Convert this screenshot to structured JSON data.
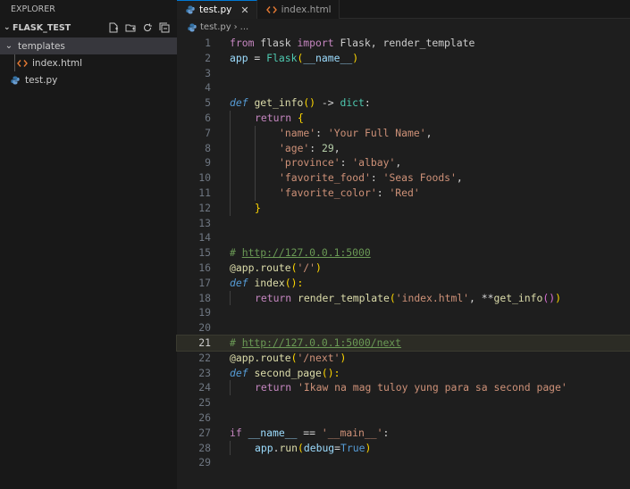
{
  "explorer": {
    "header": "EXPLORER",
    "project": "FLASK_TEST",
    "tree": [
      {
        "label": "templates",
        "type": "folder"
      },
      {
        "label": "index.html",
        "type": "html"
      },
      {
        "label": "test.py",
        "type": "python"
      }
    ]
  },
  "tabs": [
    {
      "label": "test.py",
      "active": true
    },
    {
      "label": "index.html",
      "active": false
    }
  ],
  "breadcrumb": {
    "file": "test.py",
    "rest": "..."
  },
  "colors": {
    "accent": "#0078d4",
    "python_icon": "#3572a5",
    "html_icon": "#e37933"
  },
  "code": {
    "line_numbers": [
      "1",
      "2",
      "3",
      "4",
      "5",
      "6",
      "7",
      "8",
      "9",
      "10",
      "11",
      "12",
      "13",
      "14",
      "15",
      "16",
      "17",
      "18",
      "19",
      "20",
      "21",
      "22",
      "23",
      "24",
      "25",
      "26",
      "27",
      "28",
      "29"
    ],
    "l1": [
      "from",
      " flask ",
      "import",
      " Flask, render_template"
    ],
    "l2": [
      "app",
      " = ",
      "Flask",
      "(",
      "__name__",
      ")"
    ],
    "l5": [
      "def",
      " ",
      "get_info",
      "()",
      " -> ",
      "dict",
      ":"
    ],
    "l6": [
      "return",
      " {"
    ],
    "l7": [
      "'name'",
      ": ",
      "'Your Full Name'",
      ","
    ],
    "l8": [
      "'age'",
      ": ",
      "29",
      ","
    ],
    "l9": [
      "'province'",
      ": ",
      "'albay'",
      ","
    ],
    "l10": [
      "'favorite_food'",
      ": ",
      "'Seas Foods'",
      ","
    ],
    "l11": [
      "'favorite_color'",
      ": ",
      "'Red'"
    ],
    "l12": [
      "}"
    ],
    "l15": [
      "# ",
      "http://127.0.0.1:5000"
    ],
    "l16": [
      "@app.route",
      "(",
      "'/'",
      ")"
    ],
    "l17": [
      "def",
      " ",
      "index",
      "():"
    ],
    "l18": [
      "return",
      " ",
      "render_template",
      "(",
      "'index.html'",
      ", **",
      "get_info",
      "()",
      ")"
    ],
    "l21": [
      "# ",
      "http://127.0.0.1:5000/next"
    ],
    "l22": [
      "@app.route",
      "(",
      "'/next'",
      ")"
    ],
    "l23": [
      "def",
      " ",
      "second_page",
      "():"
    ],
    "l24": [
      "return",
      " ",
      "'Ikaw na mag tuloy yung para sa second page'"
    ],
    "l27": [
      "if",
      " ",
      "__name__",
      " == ",
      "'__main__'",
      ":"
    ],
    "l28": [
      "app",
      ".",
      "run",
      "(",
      "debug",
      "=",
      "True",
      ")"
    ]
  }
}
